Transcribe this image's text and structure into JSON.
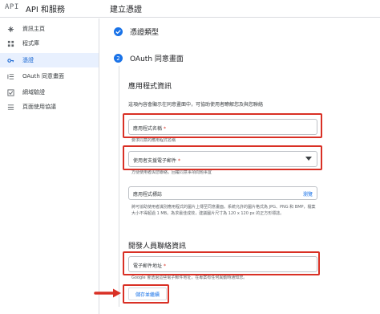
{
  "topbar": {
    "logo": "API",
    "app_title": "API 和服務",
    "page_title": "建立憑證"
  },
  "sidebar": {
    "items": [
      {
        "label": "資訊主頁",
        "icon": "dashboard-icon"
      },
      {
        "label": "程式庫",
        "icon": "library-icon"
      },
      {
        "label": "憑證",
        "icon": "key-icon",
        "active": true
      },
      {
        "label": "OAuth 同意畫面",
        "icon": "consent-icon"
      },
      {
        "label": "網域驗證",
        "icon": "checkbox-icon"
      },
      {
        "label": "頁面使用協議",
        "icon": "settings-list-icon"
      }
    ]
  },
  "steps": {
    "step1_label": "憑證類型",
    "step2_number": "2",
    "step2_label": "OAuth 同意畫面"
  },
  "app_info": {
    "title": "應用程式資訊",
    "description": "這項內容會顯示在同意畫面中，可協助使用者瞭解您及與您聯絡",
    "app_name_label": "應用程式名稱",
    "app_name_hint": "要求同意的應用程式名稱",
    "support_email_label": "使用者支援電子郵件",
    "support_email_hint": "方便使用者與您聯絡，回覆同意事項問題事宜",
    "logo_label": "應用程式標誌",
    "logo_browse": "瀏覽",
    "logo_hint": "將可協助使用者識別應用程式的圖片上傳至同意畫面。系統允許的圖片格式為 JPG、PNG 和 BMP，檔案大小不得超過 1 MB。為求最佳成效，建議圖片尺寸為 120 x 120 px 的正方形標誌。"
  },
  "developer": {
    "title": "開發人員聯絡資訊",
    "email_label": "電子郵件地址",
    "email_hint": "Google 會透過這些電子郵件地址，在專案有任何異動時通知您。"
  },
  "required_marker": "*",
  "save_button": "儲存並繼續",
  "colors": {
    "accent": "#1a73e8",
    "highlight": "#d93025",
    "active_bg": "#e8f0fe"
  }
}
